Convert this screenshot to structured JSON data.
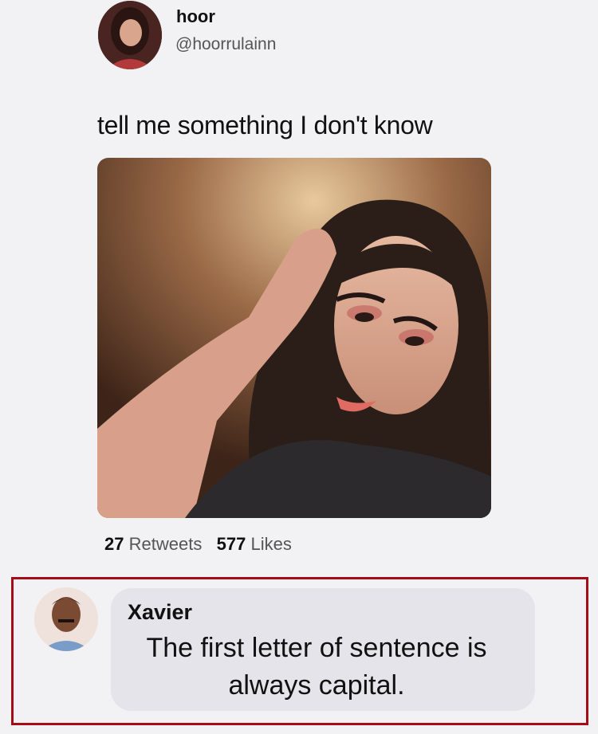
{
  "tweet": {
    "author_name": "hoor",
    "author_handle": "@hoorrulainn",
    "text": "tell me something I don't know",
    "retweets_count": "27",
    "retweets_label": "Retweets",
    "likes_count": "577",
    "likes_label": "Likes"
  },
  "reply": {
    "author_name": "Xavier",
    "text": "The first letter of sentence is always capital."
  },
  "colors": {
    "highlight_border": "#a40d16",
    "bubble_background": "#e4e4ea"
  }
}
